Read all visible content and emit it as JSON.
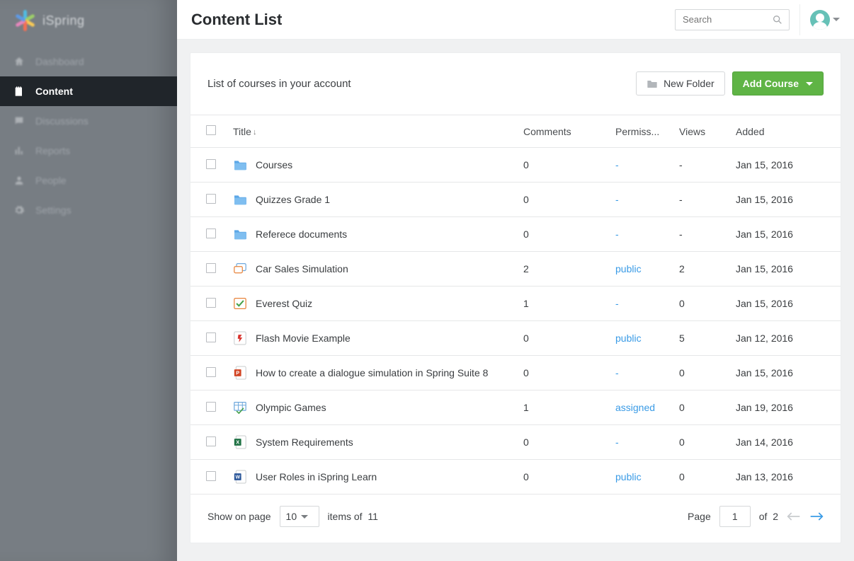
{
  "brand": {
    "name": "iSpring"
  },
  "nav": {
    "items": [
      {
        "label": "Dashboard"
      },
      {
        "label": "Content"
      },
      {
        "label": "Discussions"
      },
      {
        "label": "Reports"
      },
      {
        "label": "People"
      },
      {
        "label": "Settings"
      }
    ],
    "activeIndex": 1
  },
  "header": {
    "title": "Content List",
    "search_placeholder": "Search"
  },
  "card": {
    "subtitle": "List of courses in your account",
    "new_folder_label": "New Folder",
    "add_course_label": "Add Course"
  },
  "table": {
    "columns": {
      "title": "Title",
      "comments": "Comments",
      "permissions": "Permiss...",
      "views": "Views",
      "added": "Added"
    },
    "rows": [
      {
        "icon": "folder",
        "title": "Courses",
        "comments": "0",
        "permission": "-",
        "views": "-",
        "added": "Jan 15, 2016"
      },
      {
        "icon": "folder",
        "title": "Quizzes Grade 1",
        "comments": "0",
        "permission": "-",
        "views": "-",
        "added": "Jan 15, 2016"
      },
      {
        "icon": "folder",
        "title": "Referece documents",
        "comments": "0",
        "permission": "-",
        "views": "-",
        "added": "Jan 15, 2016"
      },
      {
        "icon": "dialogue",
        "title": "Car Sales Simulation",
        "comments": "2",
        "permission": "public",
        "views": "2",
        "added": "Jan 15, 2016"
      },
      {
        "icon": "quiz",
        "title": "Everest Quiz",
        "comments": "1",
        "permission": "-",
        "views": "0",
        "added": "Jan 15, 2016"
      },
      {
        "icon": "flash",
        "title": "Flash Movie Example",
        "comments": "0",
        "permission": "public",
        "views": "5",
        "added": "Jan 12, 2016"
      },
      {
        "icon": "ppt",
        "title": "How to create a dialogue simulation in Spring Suite 8",
        "comments": "0",
        "permission": "-",
        "views": "0",
        "added": "Jan 15, 2016"
      },
      {
        "icon": "table",
        "title": "Olympic Games",
        "comments": "1",
        "permission": "assigned",
        "views": "0",
        "added": "Jan 19, 2016"
      },
      {
        "icon": "xls",
        "title": "System Requirements",
        "comments": "0",
        "permission": "-",
        "views": "0",
        "added": "Jan 14, 2016"
      },
      {
        "icon": "doc",
        "title": "User Roles in iSpring Learn",
        "comments": "0",
        "permission": "public",
        "views": "0",
        "added": "Jan 13, 2016"
      }
    ]
  },
  "pager": {
    "show_on_page_label": "Show on page",
    "page_size": "10",
    "items_of_label": "items of",
    "total_items": "11",
    "page_label": "Page",
    "current_page": "1",
    "of_label": "of",
    "total_pages": "2"
  },
  "colors": {
    "petals": [
      "#4fc0e8",
      "#a0d468",
      "#ffce54",
      "#fc6e51",
      "#ec87c0",
      "#5d9cec"
    ]
  }
}
